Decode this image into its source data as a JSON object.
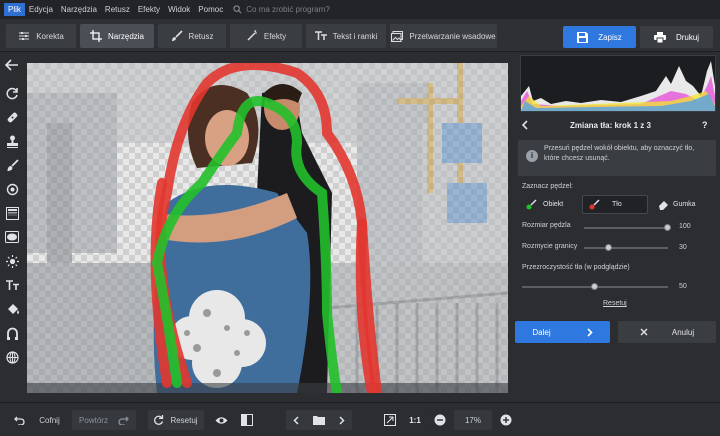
{
  "menu": {
    "items": [
      "Plik",
      "Edycja",
      "Narzędzia",
      "Retusz",
      "Efekty",
      "Widok",
      "Pomoc"
    ],
    "search_placeholder": "Co ma zrobić program?"
  },
  "tabs": [
    {
      "label": "Korekta",
      "icon": "sliders-icon"
    },
    {
      "label": "Narzędzia",
      "icon": "crop-icon"
    },
    {
      "label": "Retusz",
      "icon": "brush-icon"
    },
    {
      "label": "Efekty",
      "icon": "magic-wand-icon"
    },
    {
      "label": "Tekst i ramki",
      "icon": "text-icon"
    },
    {
      "label": "Przetwarzanie wsadowe",
      "icon": "image-stack-icon"
    }
  ],
  "actions": {
    "save": "Zapisz",
    "print": "Drukuj"
  },
  "panel": {
    "title": "Zmiana tła: krok 1 z 3",
    "help": "?",
    "info_line1": "Przesuń pędzel wokół obiektu, aby oznaczyć tło,",
    "info_line2": "które chcesz usunąć.",
    "brush_label": "Zaznacz pędzel:",
    "brushes": [
      "Obiekt",
      "Tło",
      "Gumka"
    ],
    "brush_size_label": "Rozmiar pędzla",
    "brush_size": "100",
    "brush_size_level": 1.0,
    "edge_blur_label": "Rozmycie granicy",
    "edge_blur": "30",
    "edge_blur_level": 0.3,
    "transparency_label": "Przezroczystość tła (w podglądzie)",
    "transparency": "50",
    "transparency_level": 0.5,
    "reset_link": "Resetuj",
    "next": "Dalej",
    "cancel": "Anuluj"
  },
  "bottom": {
    "undo": "Cofnij",
    "redo": "Powtórz",
    "reset": "Resetuj",
    "zoom_1to1": "1:1",
    "zoom": "17%"
  },
  "colors": {
    "accent": "#2f78e0",
    "mask_green": "#22c02a",
    "mask_red": "#e2362f"
  }
}
